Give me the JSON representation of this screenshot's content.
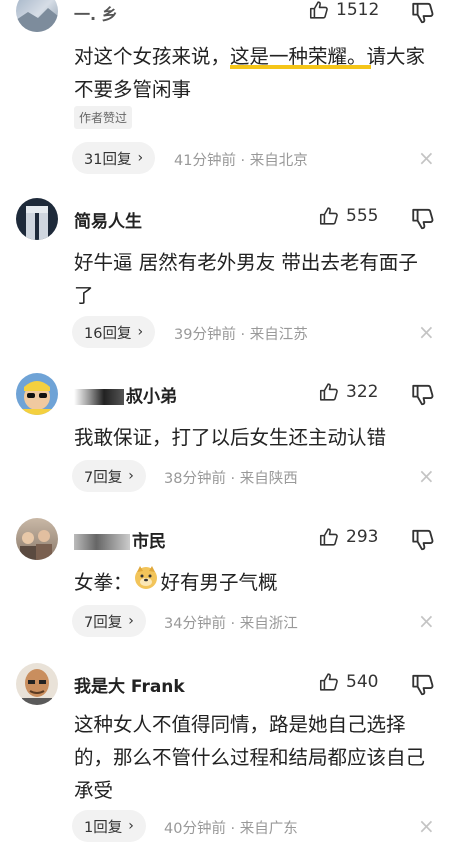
{
  "comments": [
    {
      "name": "一. 乡",
      "likes": "1512",
      "text_before": "对这个女孩来说，",
      "text_highlight": "这是一种荣耀。",
      "text_after": "请大家不要多管闲事",
      "author_tag": "作者赞过",
      "replies": "31回复",
      "meta": "41分钟前 · 来自北京",
      "avatar": "landscape-avatar"
    },
    {
      "name": "简易人生",
      "likes": "555",
      "text": "好牛逼 居然有老外男友 带出去老有面子了",
      "replies": "16回复",
      "meta": "39分钟前 · 来自江苏",
      "avatar": "building-avatar"
    },
    {
      "name": "叔小弟",
      "likes": "322",
      "text": "我敢保证，打了以后女生还主动认错",
      "replies": "7回复",
      "meta": "38分钟前 · 来自陕西",
      "avatar": "sunglasses-avatar"
    },
    {
      "name": "市民",
      "likes": "293",
      "text_before": "女拳：",
      "text_after": "好有男子气概",
      "emoji": "doge-emoji",
      "replies": "7回复",
      "meta": "34分钟前 · 来自浙江",
      "avatar": "group-photo-avatar"
    },
    {
      "name": "我是大 Frank",
      "likes": "540",
      "text": "这种女人不值得同情，路是她自己选择的，那么不管什么过程和结局都应该自己承受",
      "replies": "1回复",
      "meta": "40分钟前 · 来自广东",
      "avatar": "bald-man-avatar"
    }
  ],
  "icons": {
    "like": "thumbs-up-icon",
    "dislike": "thumbs-down-icon",
    "close": "close-icon",
    "chevron": "chevron-right-icon"
  },
  "colors": {
    "highlight_underline": "#f5c518",
    "meta_text": "#999999",
    "reply_pill_bg": "#f2f2f2"
  }
}
